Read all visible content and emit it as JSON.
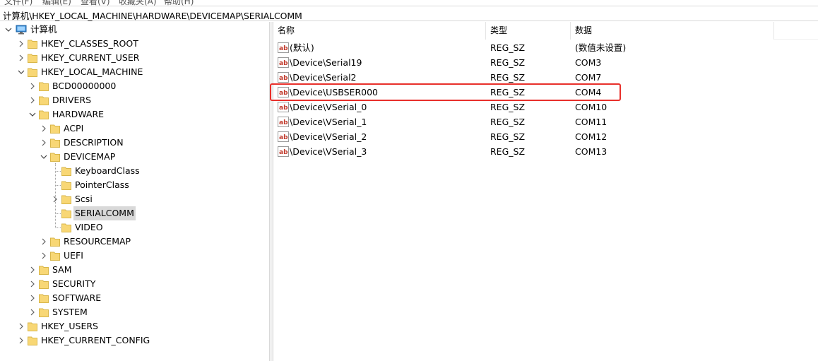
{
  "menu": [
    {
      "label": "文件(F)"
    },
    {
      "label": "编辑(E)"
    },
    {
      "label": "查看(V)"
    },
    {
      "label": "收藏夹(A)"
    },
    {
      "label": "帮助(H)"
    }
  ],
  "address": {
    "path": "计算机\\HKEY_LOCAL_MACHINE\\HARDWARE\\DEVICEMAP\\SERIALCOMM"
  },
  "tree": {
    "root": "计算机",
    "nodes": [
      {
        "label": "HKEY_CLASSES_ROOT"
      },
      {
        "label": "HKEY_CURRENT_USER"
      },
      {
        "label": "HKEY_LOCAL_MACHINE"
      },
      {
        "label": "BCD00000000"
      },
      {
        "label": "DRIVERS"
      },
      {
        "label": "HARDWARE"
      },
      {
        "label": "ACPI"
      },
      {
        "label": "DESCRIPTION"
      },
      {
        "label": "DEVICEMAP"
      },
      {
        "label": "KeyboardClass"
      },
      {
        "label": "PointerClass"
      },
      {
        "label": "Scsi"
      },
      {
        "label": "SERIALCOMM"
      },
      {
        "label": "VIDEO"
      },
      {
        "label": "RESOURCEMAP"
      },
      {
        "label": "UEFI"
      },
      {
        "label": "SAM"
      },
      {
        "label": "SECURITY"
      },
      {
        "label": "SOFTWARE"
      },
      {
        "label": "SYSTEM"
      },
      {
        "label": "HKEY_USERS"
      },
      {
        "label": "HKEY_CURRENT_CONFIG"
      }
    ],
    "selected": "SERIALCOMM"
  },
  "list": {
    "columns": [
      {
        "label": "名称"
      },
      {
        "label": "类型"
      },
      {
        "label": "数据"
      }
    ],
    "rows": [
      {
        "name": "(默认)",
        "type": "REG_SZ",
        "data": "(数值未设置)"
      },
      {
        "name": "\\Device\\Serial19",
        "type": "REG_SZ",
        "data": "COM3"
      },
      {
        "name": "\\Device\\Serial2",
        "type": "REG_SZ",
        "data": "COM7"
      },
      {
        "name": "\\Device\\USBSER000",
        "type": "REG_SZ",
        "data": "COM4"
      },
      {
        "name": "\\Device\\VSerial_0",
        "type": "REG_SZ",
        "data": "COM10"
      },
      {
        "name": "\\Device\\VSerial_1",
        "type": "REG_SZ",
        "data": "COM11"
      },
      {
        "name": "\\Device\\VSerial_2",
        "type": "REG_SZ",
        "data": "COM12"
      },
      {
        "name": "\\Device\\VSerial_3",
        "type": "REG_SZ",
        "data": "COM13"
      }
    ],
    "highlighted_row": "\\Device\\USBSER000"
  },
  "colors": {
    "highlight_box": "#e8302b",
    "selection": "#d9d9d9",
    "folder": "#f8d775"
  },
  "icons": {
    "root": "computer-icon",
    "folder": "folder-icon",
    "value": "string-value-icon",
    "collapsed": "chevron-right-icon",
    "expanded": "chevron-down-icon"
  }
}
